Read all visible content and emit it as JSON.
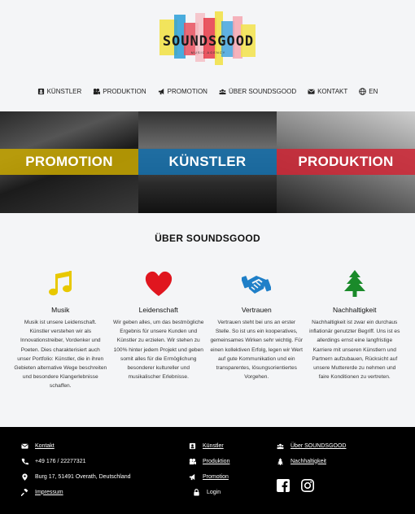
{
  "brand": {
    "name": "SOUNDSGOOD",
    "tagline": "MUSIC AGENCY"
  },
  "nav": {
    "items": [
      {
        "label": "KÜNSTLER",
        "icon": "artist-icon"
      },
      {
        "label": "PRODUKTION",
        "icon": "production-icon"
      },
      {
        "label": "PROMOTION",
        "icon": "megaphone-icon"
      },
      {
        "label": "ÜBER SOUNDSGOOD",
        "icon": "group-icon"
      },
      {
        "label": "KONTAKT",
        "icon": "envelope-icon"
      },
      {
        "label": "EN",
        "icon": "globe-icon"
      }
    ]
  },
  "hero": {
    "panels": [
      {
        "label": "PROMOTION",
        "color": "#c9a800"
      },
      {
        "label": "KÜNSTLER",
        "color": "#166eaa"
      },
      {
        "label": "PRODUKTION",
        "color": "#cd2837"
      }
    ]
  },
  "about": {
    "title": "ÜBER SOUNDSGOOD",
    "features": [
      {
        "title": "Musik",
        "icon": "music-note-icon",
        "color": "#e8c800",
        "text": "Musik ist unsere Leidenschaft. Künstler verstehen wir als Innovationstreiber, Vordenker und Poeten. Dies charakterisiert auch unser Portfolio: Künstler, die in ihren Gebieten alternative Wege beschreiten und besondere Klangerlebnisse schaffen."
      },
      {
        "title": "Leidenschaft",
        "icon": "heart-icon",
        "color": "#e0161f",
        "text": "Wir geben alles, um das bestmögliche Ergebnis für unsere Kunden und Künstler zu erzielen. Wir stehen zu 100% hinter jedem Projekt und geben somit alles für die Ermöglichung besonderer kultureller und musikalischer Erlebnisse."
      },
      {
        "title": "Vertrauen",
        "icon": "handshake-icon",
        "color": "#1f7fc8",
        "text": "Vertrauen steht bei uns an erster Stelle. So ist uns ein kooperatives, gemeinsames Wirken sehr wichtig. Für einen kollektiven Erfolg, legen wir Wert auf gute Kommunikation und ein transparentes, lösungsorientiertes Vorgehen."
      },
      {
        "title": "Nachhaltigkeit",
        "icon": "tree-icon",
        "color": "#1a8a2a",
        "text": "Nachhaltigkeit ist zwar ein durchaus inflationär genutzter Begriff. Uns ist es allerdings ernst eine langfristige Karriere mit unseren Künstlern und Partnern aufzubauen, Rücksicht auf unsere Muttererde zu nehmen und faire Konditionen zu vertreten."
      }
    ]
  },
  "footer": {
    "contact": {
      "kontakt": "Kontakt",
      "phone": "+49 176 / 22277321",
      "address": "Burg 17, 51491 Overath, Deutschland",
      "impressum": "Impressum"
    },
    "links1": {
      "kuenstler": "Künstler",
      "produktion": "Produktion",
      "promotion": "Promotion",
      "login": "Login"
    },
    "links2": {
      "about": "Über SOUNDSGOOD",
      "nachhaltigkeit": "Nachhaltigkeit"
    },
    "social": [
      "facebook-icon",
      "instagram-icon"
    ]
  }
}
